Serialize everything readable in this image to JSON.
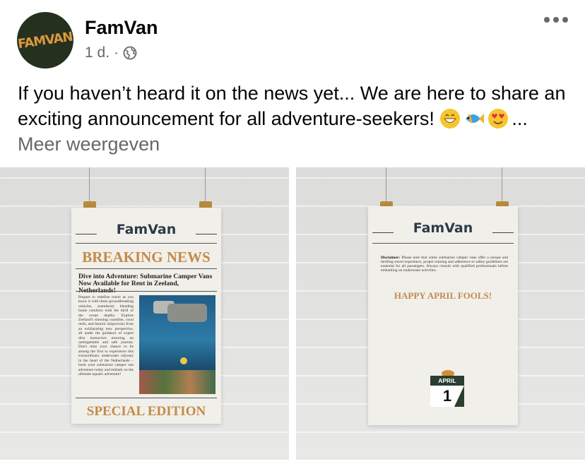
{
  "post": {
    "page_name": "FamVan",
    "avatar_logo": "FAMVAN",
    "time": "1 d.",
    "separator": "·",
    "text": "If you haven’t heard it on the news yet... We are here to share an exciting announcement for all adventure-seekers!",
    "ellipsis": "...",
    "see_more": "Meer weergeven",
    "emojis": [
      "grinning-face-emoji",
      "tropical-fish-emoji",
      "heart-eyes-emoji"
    ]
  },
  "poster_left": {
    "brand": "FamVan",
    "title": "BREAKING NEWS",
    "headline": "Dive into Adventure: Submarine Camper Vans Now Available for Rent in Zeeland, Netherlands!",
    "body": "Prepare to redefine travel as you know it with these groundbreaking vehicles, seamlessly blending home comforts with the thrill of the ocean depths. Explore Zeeland's stunning coastline, coral reefs, and historic shipwrecks from an exhilarating new perspective, all under the guidance of expert dive instructors ensuring an unforgettable and safe journey. Don't miss your chance to be among the first to experience this extraordinary underwater odyssey in the heart of the Netherlands – book your submarine camper van adventure today and embark on the ultimate aquatic adventure!",
    "footer": "SPECIAL EDITION"
  },
  "poster_right": {
    "brand": "FamVan",
    "disclaimer_label": "Disclaimer:",
    "disclaimer": "Please note that while submarine camper vans offer a unique and thrilling travel experience, proper training and adherence to safety guidelines are essential for all passengers. Always consult with qualified professionals before embarking on underwater activities.",
    "message": "HAPPY APRIL FOOLS!",
    "calendar_month": "APRIL",
    "calendar_day": "1"
  },
  "colors": {
    "accent": "#c48a4a",
    "text": "#050505",
    "muted": "#65676b",
    "avatar_bg": "#25301f"
  }
}
